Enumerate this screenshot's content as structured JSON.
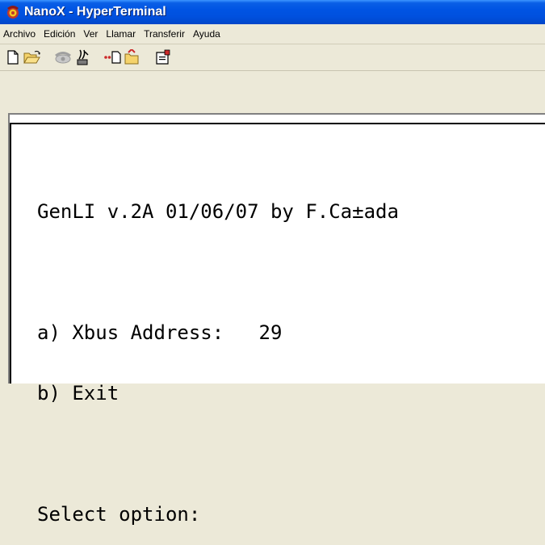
{
  "window": {
    "title": "NanoX - HyperTerminal",
    "app_icon": "hyperterminal-phone-icon"
  },
  "menu": {
    "items": [
      "Archivo",
      "Edición",
      "Ver",
      "Llamar",
      "Transferir",
      "Ayuda"
    ]
  },
  "toolbar": {
    "buttons": [
      {
        "icon": "new-document-icon"
      },
      {
        "icon": "open-folder-icon"
      },
      {
        "icon": "call-phone-icon"
      },
      {
        "icon": "disconnect-icon"
      },
      {
        "icon": "send-file-icon"
      },
      {
        "icon": "receive-file-icon"
      },
      {
        "icon": "properties-icon"
      }
    ]
  },
  "terminal": {
    "lines": [
      "GenLI v.2A 01/06/07 by F.Ca±ada",
      "",
      "a) Xbus Address:   29",
      "b) Exit",
      "",
      "Select option:"
    ]
  },
  "colors": {
    "titlebar": "#0054e3",
    "chrome": "#ece9d8",
    "terminal_bg": "#ffffff",
    "terminal_text": "#000000"
  }
}
